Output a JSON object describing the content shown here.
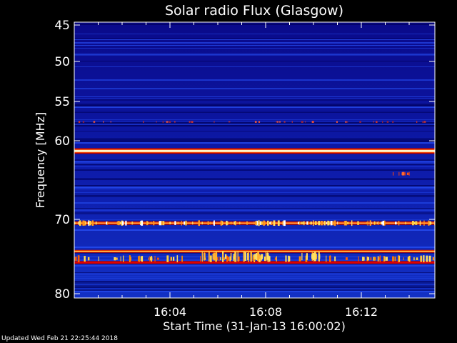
{
  "chart_data": {
    "type": "heatmap",
    "title": "Solar radio Flux (Glasgow)",
    "xlabel": "Start Time (31-Jan-13 16:00:02)",
    "ylabel": "Frequency [MHz]",
    "x_ticks": [
      "16:04",
      "16:08",
      "16:12"
    ],
    "x_tick_minutes": [
      4,
      8,
      12
    ],
    "xlim_minutes": [
      0,
      15
    ],
    "y_ticks": [
      45,
      50,
      55,
      60,
      70,
      80
    ],
    "ylim": [
      44,
      80
    ],
    "y_scale": "nonlinear (log-like, 60–70 compressed)",
    "colormap": [
      "#000010",
      "#0000a0",
      "#1a3cff",
      "#c00000",
      "#ff6a00",
      "#ffe060",
      "#ffffff"
    ],
    "background_level": "dark blue",
    "bands": [
      {
        "freq_mhz": 57.6,
        "intensity": "weak red, intermittent"
      },
      {
        "freq_mhz": 61.3,
        "intensity": "strong, continuous (red-white)"
      },
      {
        "freq_mhz": 64.2,
        "intensity": "weak red, short burst near 16:13"
      },
      {
        "freq_mhz": 70.5,
        "intensity": "strong, continuous with yellow spikes"
      },
      {
        "freq_mhz": 74.3,
        "intensity": "strong, continuous (orange)"
      },
      {
        "freq_mhz": 75.3,
        "intensity": "intermittent yellow/orange spikes"
      },
      {
        "freq_mhz": 75.8,
        "intensity": "strong, continuous (red)"
      }
    ]
  },
  "footer": {
    "updated": "Updated Wed Feb 21 22:25:44 2018"
  }
}
